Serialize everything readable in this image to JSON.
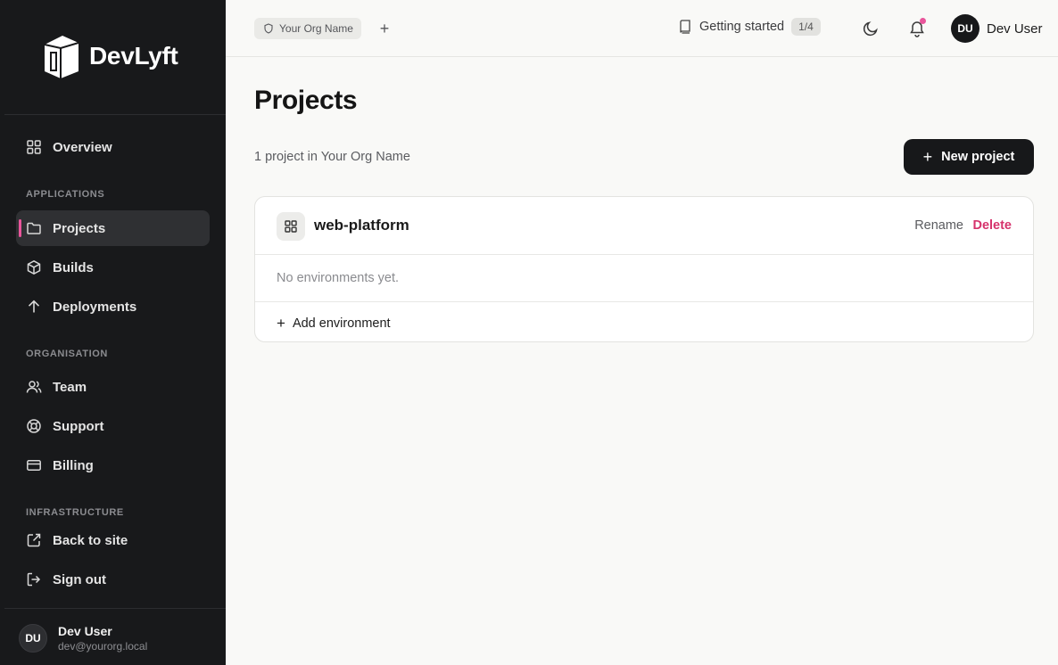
{
  "brand": {
    "name": "DevLyft"
  },
  "sidebar": {
    "overview": {
      "label": "Overview"
    },
    "sections": {
      "applications": "APPLICATIONS",
      "organisation": "ORGANISATION",
      "infrastructure": "INFRASTRUCTURE"
    },
    "items": {
      "projects": {
        "label": "Projects",
        "active": true
      },
      "builds": {
        "label": "Builds"
      },
      "deployments": {
        "label": "Deployments"
      },
      "team": {
        "label": "Team"
      },
      "support": {
        "label": "Support"
      },
      "billing": {
        "label": "Billing"
      },
      "back_to_site": {
        "label": "Back to site"
      },
      "sign_out": {
        "label": "Sign out"
      }
    },
    "user": {
      "initials": "DU",
      "name": "Dev User",
      "email": "dev@yourorg.local"
    }
  },
  "topbar": {
    "org": {
      "name": "Your Org Name",
      "add_label": "+"
    },
    "getting_started": {
      "label": "Getting started",
      "progress": "1/4"
    },
    "user": {
      "initials": "DU",
      "name": "Dev User"
    },
    "has_notifications": true
  },
  "main": {
    "title": "Projects",
    "subtitle": "1 project in Your Org Name",
    "new_project_label": "New project",
    "new_project_plus": "+",
    "projects": [
      {
        "name": "web-platform",
        "rename_label": "Rename",
        "delete_label": "Delete",
        "empty_text": "No environments yet.",
        "add_env_label": "Add environment",
        "add_env_plus": "+"
      }
    ]
  },
  "colors": {
    "sidebar_bg": "#18191b",
    "accent": "#e9559b",
    "danger": "#d6336c",
    "primary_button": "#17181a",
    "page_bg": "#f9f9f7"
  }
}
